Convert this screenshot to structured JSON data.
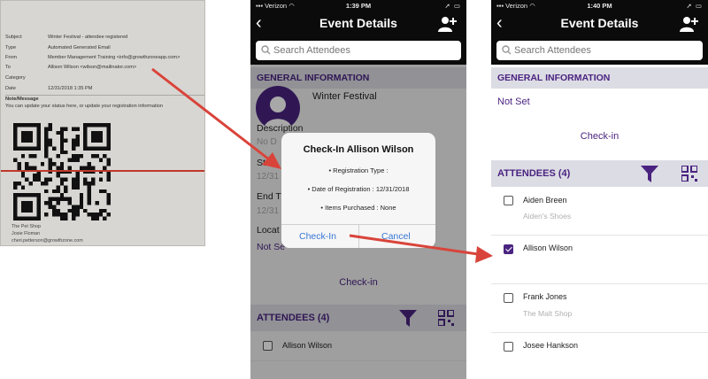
{
  "email": {
    "fields": [
      {
        "label": "Subject",
        "value": "Winter Festival - attendee registered"
      },
      {
        "label": "Type",
        "value": "Automated Generated Email"
      },
      {
        "label": "From",
        "value": "Member Management Training <info@growthzoneapp.com>"
      },
      {
        "label": "To",
        "value": "Allison Wilson <wilson@mailinator.com>"
      },
      {
        "label": "Category",
        "value": ""
      },
      {
        "label": "Date",
        "value": "12/31/2018 1:35 PM"
      }
    ],
    "note_label": "Note/Message",
    "note_text": "You can update your status here, or update your registration information",
    "footer": [
      "The Pet Shop",
      "Josie Floman",
      "cheri.petterson@growthzone.com"
    ]
  },
  "phone2": {
    "status": {
      "carrier": "Verizon",
      "time": "1:39 PM"
    },
    "title": "Event Details",
    "search_placeholder": "Search Attendees",
    "general_info": "GENERAL INFORMATION",
    "event_name": "Winter Festival",
    "fields": {
      "description": "Description",
      "description_value": "No D",
      "start": "Start",
      "start_value": "12/31",
      "end": "End T",
      "end_value": "12/31",
      "location": "Locat",
      "location_value": "Not Se"
    },
    "checkin_link": "Check-in",
    "attendees_label": "ATTENDEES (4)",
    "attendees": [
      {
        "name": "Allison Wilson",
        "checked": false
      }
    ],
    "dialog": {
      "title": "Check-In Allison Wilson",
      "lines": [
        "• Registration Type :",
        "• Date of Registration : 12/31/2018",
        "• Items Purchased : None"
      ],
      "checkin_button": "Check-In",
      "cancel_button": "Cancel"
    }
  },
  "phone3": {
    "status": {
      "carrier": "Verizon",
      "time": "1:40 PM"
    },
    "title": "Event Details",
    "search_placeholder": "Search Attendees",
    "general_info": "GENERAL INFORMATION",
    "location_value": "Not Set",
    "checkin_link": "Check-in",
    "attendees_label": "ATTENDEES (4)",
    "attendees": [
      {
        "name": "Aiden Breen",
        "org": "Aiden's Shoes",
        "checked": false
      },
      {
        "name": "Allison Wilson",
        "org": "",
        "checked": true
      },
      {
        "name": "Frank Jones",
        "org": "The Malt Shop",
        "checked": false
      },
      {
        "name": "Josee Hankson",
        "org": "",
        "checked": false
      }
    ]
  },
  "colors": {
    "brand_purple": "#4a2380",
    "ios_blue": "#3877d6",
    "arrow_red": "#d9443a",
    "navbar": "#0b0b0b"
  }
}
